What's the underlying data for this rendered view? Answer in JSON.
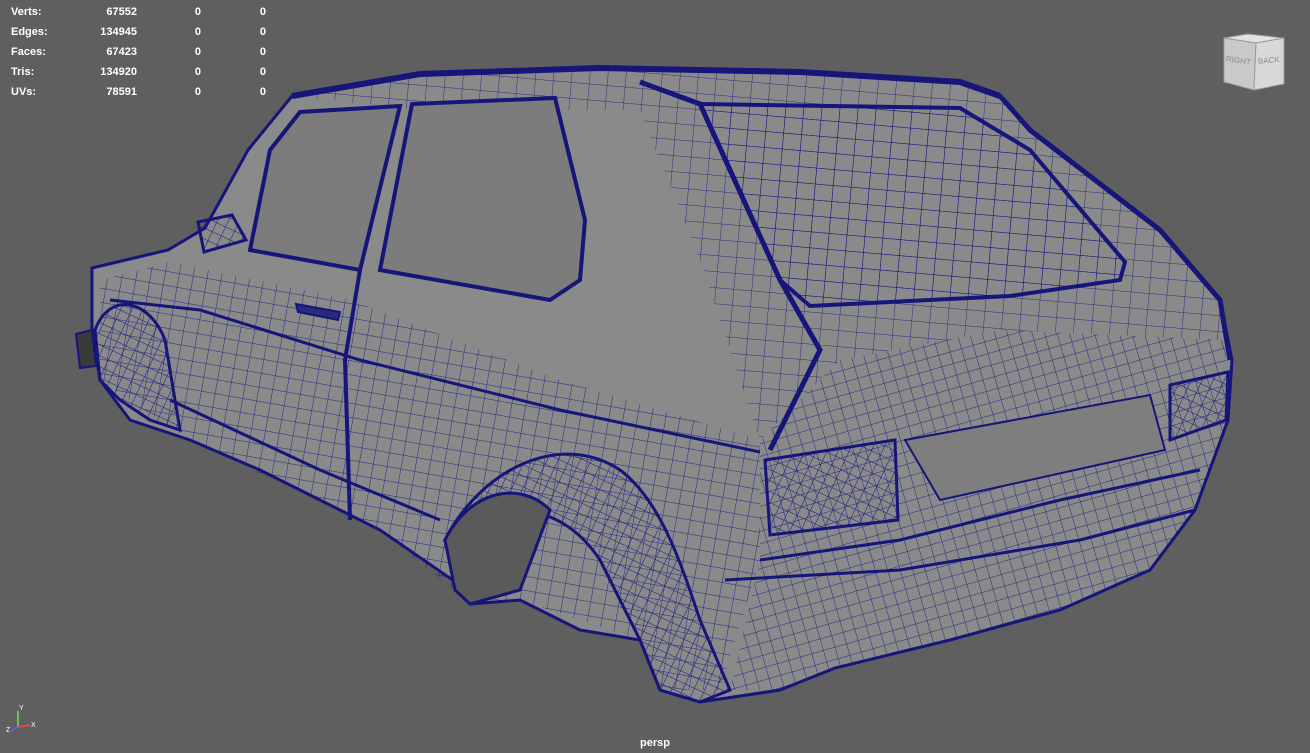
{
  "hud": {
    "rows": [
      {
        "label": "Verts:",
        "total": "67552",
        "selected": "0",
        "components": "0"
      },
      {
        "label": "Edges:",
        "total": "134945",
        "selected": "0",
        "components": "0"
      },
      {
        "label": "Faces:",
        "total": "67423",
        "selected": "0",
        "components": "0"
      },
      {
        "label": "Tris:",
        "total": "134920",
        "selected": "0",
        "components": "0"
      },
      {
        "label": "UVs:",
        "total": "78591",
        "selected": "0",
        "components": "0"
      }
    ]
  },
  "viewcube": {
    "right_face": "RIGHT",
    "back_face": "BACK"
  },
  "axis": {
    "y": "Y",
    "x": "X",
    "z": "Z"
  },
  "camera": "persp",
  "colors": {
    "background": "#5f5f5f",
    "wire": "#15157a",
    "surface": "#8a8a8a"
  }
}
